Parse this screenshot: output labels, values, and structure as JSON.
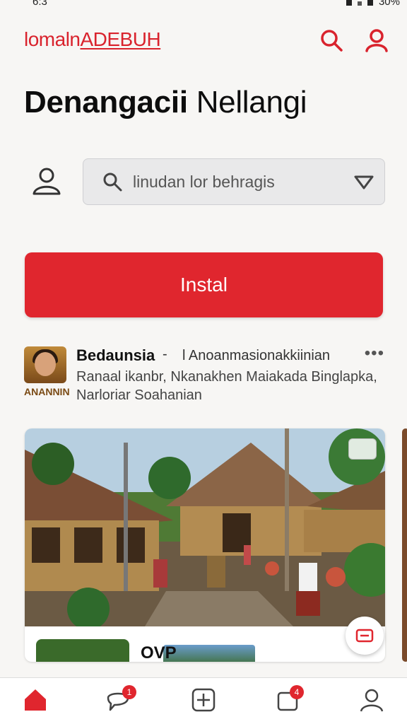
{
  "status_bar": {
    "left": "6:3",
    "right": "30%"
  },
  "header": {
    "brand_plain": "lomaln",
    "brand_underlined": "ADEBUH",
    "brand_color": "#d9232d"
  },
  "page": {
    "title_bold": "Denangacii",
    "title_light": "Nellangi"
  },
  "search": {
    "placeholder": "linudan lor behragis"
  },
  "install": {
    "label": "Instal",
    "color": "#e0262e"
  },
  "post": {
    "name": "Bedaunsia",
    "separator": "-",
    "tag": "l Anoanmasionakkiinian",
    "description": "Ranaal ikanbr, Nkanakhen Maiakada Binglapka, Narloriar Soahanian",
    "badge": "ANANNIN",
    "more": "•••"
  },
  "card": {
    "thumb_label": "OVP"
  },
  "bottom_nav": {
    "items": [
      {
        "icon": "home-icon",
        "label": "",
        "active": true
      },
      {
        "icon": "chat-icon",
        "label": "",
        "badge": "1"
      },
      {
        "icon": "add-icon",
        "label": ""
      },
      {
        "icon": "notifications-icon",
        "label": "",
        "badge": "4"
      },
      {
        "icon": "profile-icon",
        "label": ""
      }
    ]
  }
}
